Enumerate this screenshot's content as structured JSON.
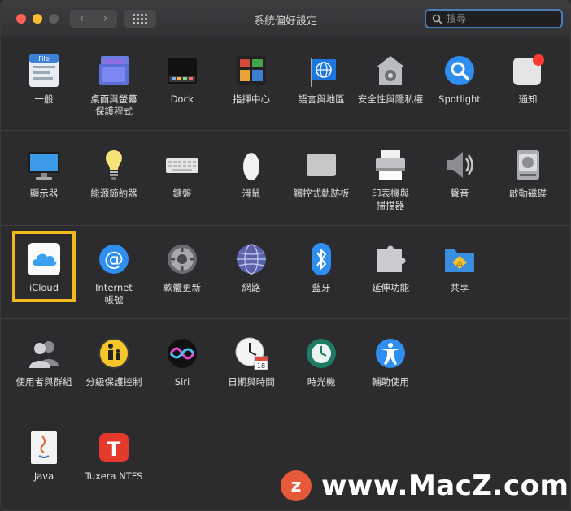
{
  "window": {
    "title": "系統偏好設定"
  },
  "search": {
    "placeholder": "搜尋"
  },
  "nav": {
    "back": "‹",
    "forward": "›"
  },
  "rows": [
    [
      {
        "id": "general",
        "label": "一般"
      },
      {
        "id": "desktop",
        "label": "桌面與螢幕\n保護程式"
      },
      {
        "id": "dock",
        "label": "Dock"
      },
      {
        "id": "mission",
        "label": "指揮中心"
      },
      {
        "id": "language",
        "label": "語言與地區"
      },
      {
        "id": "security",
        "label": "安全性與隱私權"
      },
      {
        "id": "spotlight",
        "label": "Spotlight"
      },
      {
        "id": "notifications",
        "label": "通知"
      }
    ],
    [
      {
        "id": "displays",
        "label": "顯示器"
      },
      {
        "id": "energy",
        "label": "能源節約器"
      },
      {
        "id": "keyboard",
        "label": "鍵盤"
      },
      {
        "id": "mouse",
        "label": "滑鼠"
      },
      {
        "id": "trackpad",
        "label": "觸控式軌跡板"
      },
      {
        "id": "printers",
        "label": "印表機與\n掃描器"
      },
      {
        "id": "sound",
        "label": "聲音"
      },
      {
        "id": "startup",
        "label": "啟動磁碟"
      }
    ],
    [
      {
        "id": "icloud",
        "label": "iCloud"
      },
      {
        "id": "internet",
        "label": "Internet\n帳號"
      },
      {
        "id": "software",
        "label": "軟體更新"
      },
      {
        "id": "network",
        "label": "網路"
      },
      {
        "id": "bluetooth",
        "label": "藍牙"
      },
      {
        "id": "extensions",
        "label": "延伸功能"
      },
      {
        "id": "sharing",
        "label": "共享"
      }
    ],
    [
      {
        "id": "users",
        "label": "使用者與群組"
      },
      {
        "id": "parental",
        "label": "分級保護控制"
      },
      {
        "id": "siri",
        "label": "Siri"
      },
      {
        "id": "datetime",
        "label": "日期與時間"
      },
      {
        "id": "timemachine",
        "label": "時光機"
      },
      {
        "id": "accessibility",
        "label": "輔助使用"
      }
    ],
    [
      {
        "id": "java",
        "label": "Java"
      },
      {
        "id": "tuxera",
        "label": "Tuxera NTFS"
      }
    ]
  ],
  "watermark": {
    "logo": "z",
    "text": "www.MacZ.com"
  }
}
